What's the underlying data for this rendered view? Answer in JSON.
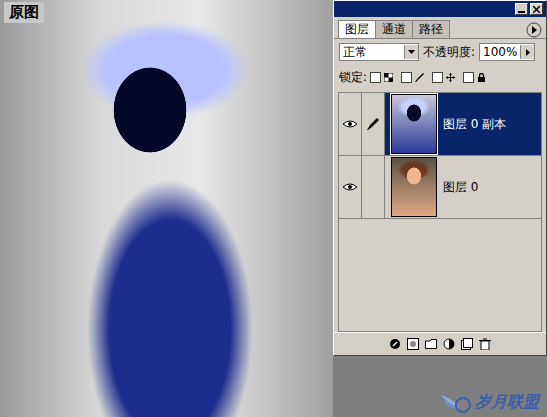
{
  "caption": "原图",
  "panel": {
    "tabs": [
      {
        "label": "图层",
        "selected": true
      },
      {
        "label": "通道",
        "selected": false
      },
      {
        "label": "路径",
        "selected": false
      }
    ],
    "blend_mode": "正常",
    "opacity_label": "不透明度:",
    "opacity": "100%",
    "lock_label": "锁定:",
    "lock_options": [
      {
        "checked": false
      },
      {
        "checked": false
      },
      {
        "checked": false
      },
      {
        "checked": false
      }
    ],
    "layers": [
      {
        "name": "图层 0 副本",
        "visible": true,
        "selected": true,
        "editing": true,
        "kind": "inverted"
      },
      {
        "name": "图层 0",
        "visible": true,
        "selected": false,
        "editing": false,
        "kind": "original"
      }
    ]
  },
  "watermark": "岁月联盟"
}
